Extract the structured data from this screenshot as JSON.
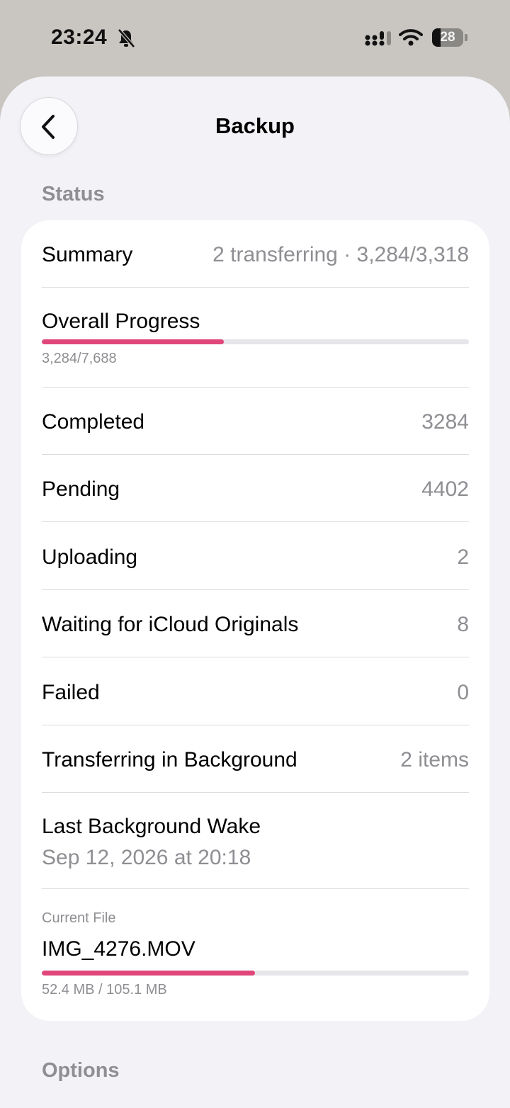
{
  "status_bar": {
    "time": "23:24",
    "battery_level": "28",
    "battery_fraction": 0.28,
    "icons": [
      "bell-slash-icon",
      "signal-icon",
      "wifi-icon",
      "battery-icon"
    ]
  },
  "nav": {
    "title": "Backup",
    "back_icon": "chevron-left-icon"
  },
  "status_section": {
    "header": "Status",
    "summary": {
      "label": "Summary",
      "value": "2 transferring · 3,284/3,318"
    },
    "overall_progress": {
      "label": "Overall Progress",
      "detail": "3,284/7,688",
      "fraction": 0.427
    },
    "rows": [
      {
        "label": "Completed",
        "value": "3284"
      },
      {
        "label": "Pending",
        "value": "4402"
      },
      {
        "label": "Uploading",
        "value": "2"
      },
      {
        "label": "Waiting for iCloud Originals",
        "value": "8"
      },
      {
        "label": "Failed",
        "value": "0"
      },
      {
        "label": "Transferring in Background",
        "value": "2 items"
      }
    ],
    "last_wake": {
      "label": "Last Background Wake",
      "value": "Sep 12, 2026 at 20:18"
    },
    "current_file": {
      "caption": "Current File",
      "name": "IMG_4276.MOV",
      "detail": "52.4 MB / 105.1 MB",
      "fraction": 0.4986
    }
  },
  "options_section": {
    "header": "Options"
  },
  "colors": {
    "accent": "#e0467a",
    "secondary_text": "#8e8e93",
    "background": "#f2f2f7",
    "card": "#ffffff"
  }
}
